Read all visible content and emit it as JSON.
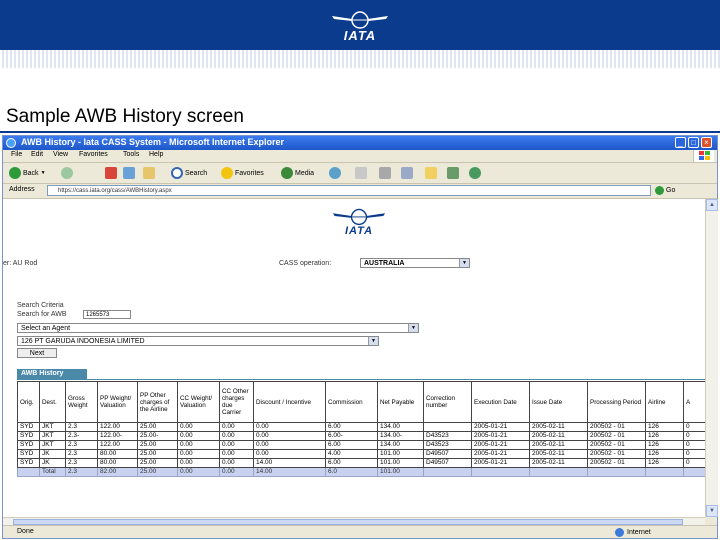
{
  "slide": {
    "logo_text": "IATA",
    "title": "Sample AWB History screen"
  },
  "browser": {
    "window_title": "AWB History - Iata CASS System - Microsoft Internet Explorer",
    "menu": [
      "File",
      "Edit",
      "View",
      "Favorites",
      "Tools",
      "Help"
    ],
    "toolbar": {
      "back": "Back",
      "search": "Search",
      "favorites": "Favorites",
      "media": "Media"
    },
    "address_label": "Address",
    "address_value": "https://cass.iata.org/cass/AWBHistory.aspx",
    "go_label": "Go",
    "status": "Done",
    "zone": "Internet"
  },
  "page": {
    "logo_text": "IATA",
    "user_label": "er: AU Rod",
    "cass_label": "CASS operation:",
    "cass_value": "AUSTRALIA",
    "search_label": "Search Criteria",
    "search_for_label": "Search for AWB",
    "awb_value": "1265573",
    "agent_select": "Select an Agent",
    "agent_name": "126 PT GARUDA INDONESIA LIMITED",
    "next_button": "Next",
    "tab_label": "AWB History"
  },
  "table": {
    "headers": [
      "Orig.",
      "Dest.",
      "Gross Weight",
      "PP Weight/ Valuation",
      "PP Other charges of the Airline",
      "CC Weight/ Valuation",
      "CC Other charges due Carrier",
      "Discount / Incentive",
      "Commission",
      "Net Payable",
      "Correction number",
      "Execution Date",
      "Issue Date",
      "Processing Period",
      "Airline",
      "A"
    ],
    "rows": [
      [
        "SYD",
        "JKT",
        "2.3",
        "122.00",
        "25.00",
        "0.00",
        "0.00",
        "0.00",
        "6.00",
        "134.00",
        "",
        "2005-01-21",
        "2005-02-11",
        "200502 - 01",
        "126",
        "0"
      ],
      [
        "SYD",
        "JKT",
        "2.3-",
        "122.00-",
        "25.00-",
        "0.00",
        "0.00",
        "0.00",
        "6.00-",
        "134.00-",
        "D43523",
        "2005-01-21",
        "2005-02-11",
        "200502 - 01",
        "126",
        "0"
      ],
      [
        "SYD",
        "JKT",
        "2.3",
        "122.00",
        "25.00",
        "0.00",
        "0.00",
        "0.00",
        "6.00",
        "134.00",
        "D43523",
        "2005-01-21",
        "2005-02-11",
        "200502 - 01",
        "126",
        "0"
      ],
      [
        "SYD",
        "JK",
        "2.3",
        "80.00",
        "25.00",
        "0.00",
        "0.00",
        "0.00",
        "4.00",
        "101.00",
        "D49507",
        "2005-01-21",
        "2005-02-11",
        "200502 - 01",
        "126",
        "0"
      ],
      [
        "SYD",
        "JK",
        "2.3",
        "80.00",
        "25.00",
        "0.00",
        "0.00",
        "14.00",
        "6.00",
        "101.00",
        "D49507",
        "2005-01-21",
        "2005-02-11",
        "200502 - 01",
        "126",
        "0"
      ]
    ],
    "total": [
      "",
      "Total",
      "2.3",
      "82.00",
      "25.00",
      "0.00",
      "0.00",
      "14.00",
      "6.0",
      "101.00",
      "",
      "",
      "",
      "",
      "",
      ""
    ]
  }
}
